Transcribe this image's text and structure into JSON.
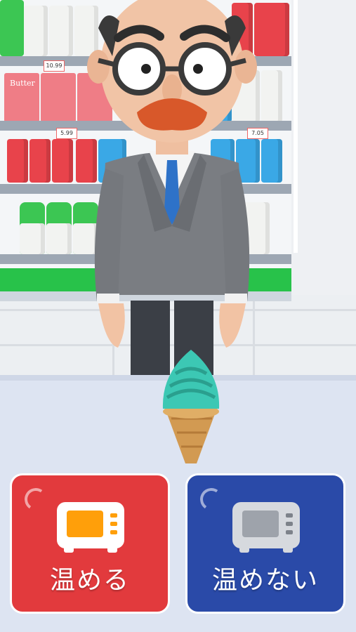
{
  "scene": {
    "shelf_brand_label": "Butter",
    "price_tags": [
      "10.99",
      "5.99",
      "7.05"
    ]
  },
  "buttons": {
    "warm": {
      "label": "温める",
      "color": "#e23a3d"
    },
    "no_warm": {
      "label": "温めない",
      "color": "#2a4aa8"
    }
  },
  "item": {
    "name": "soft-serve-ice-cream",
    "color": "#3cc8b4"
  }
}
